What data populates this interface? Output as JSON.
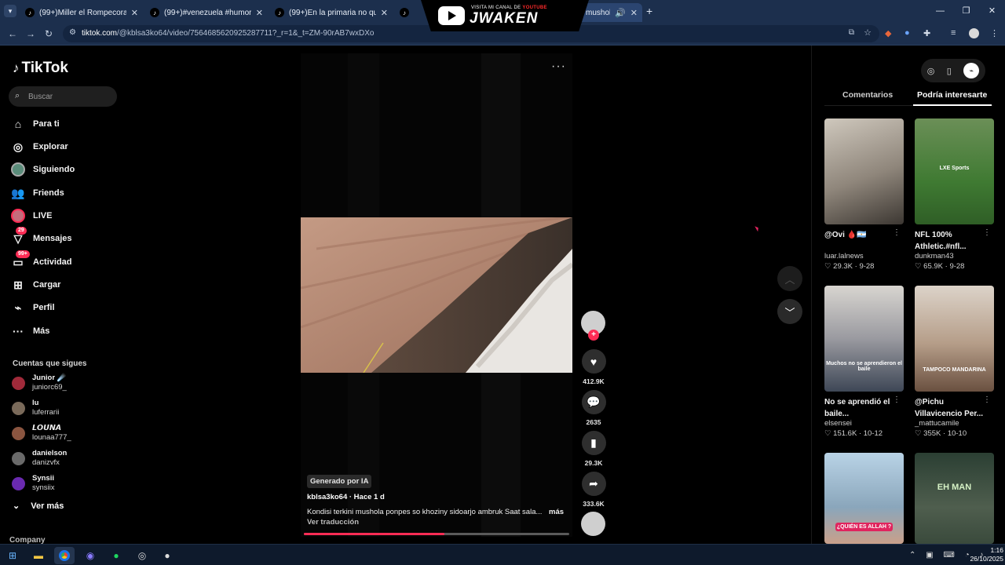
{
  "browser": {
    "tabs": [
      {
        "title": "(99+)Miller el Rompecorazones"
      },
      {
        "title": "(99+)#venezuela #humor #shit"
      },
      {
        "title": "(99+)En la primaria no querías"
      },
      {
        "title": "mushol"
      }
    ],
    "url_host": "tiktok.com",
    "url_path": "/@kblsa3ko64/video/7564685620925287711?_r=1&_t=ZM-90rAB7wxDXo",
    "new_tab": "+"
  },
  "banner": {
    "small_prefix": "VISITA MI CANAL DE",
    "small_brand": "YOUTUBE",
    "title": "JWAKEN"
  },
  "sidebar": {
    "logo": "TikTok",
    "search_placeholder": "Buscar",
    "nav": [
      {
        "label": "Para ti",
        "icon": "home-icon"
      },
      {
        "label": "Explorar",
        "icon": "compass-icon"
      },
      {
        "label": "Siguiendo",
        "icon": "following-avatar-icon"
      },
      {
        "label": "Friends",
        "icon": "friends-icon"
      },
      {
        "label": "LIVE",
        "icon": "live-icon"
      },
      {
        "label": "Mensajes",
        "icon": "messages-icon",
        "badge": "29"
      },
      {
        "label": "Actividad",
        "icon": "activity-icon",
        "badge": "99+"
      },
      {
        "label": "Cargar",
        "icon": "upload-icon"
      },
      {
        "label": "Perfil",
        "icon": "profile-icon"
      },
      {
        "label": "Más",
        "icon": "more-icon"
      }
    ],
    "following_header": "Cuentas que sigues",
    "accounts": [
      {
        "name": "Junior ☄️",
        "handle": "juniorc69_",
        "color": "#a02a3a"
      },
      {
        "name": "lu",
        "handle": "luferrarii",
        "color": "#7a6a5a"
      },
      {
        "name": "𝙇𝙊𝙐𝙉𝘼",
        "handle": "lounaa777_",
        "color": "#8a5540"
      },
      {
        "name": "danielson",
        "handle": "danizvfx",
        "color": "#6a6a6a"
      },
      {
        "name": "Synsii",
        "handle": "synsiix",
        "color": "#6a2ab0"
      }
    ],
    "see_more": "Ver más",
    "company": "Company"
  },
  "video": {
    "ai_badge": "Generado por IA",
    "author_line": "kblsa3ko64 · Hace 1 d",
    "caption": "Kondisi terkini mushola ponpes so khoziny sidoarjo ambruk Saat sala...",
    "more": "más",
    "translate": "Ver traducción",
    "progress": 0.53,
    "likes": "412.9K",
    "comments": "2635",
    "saves": "29.3K",
    "shares": "333.6K"
  },
  "right_panel": {
    "tabs": [
      "Comentarios",
      "Podría interesarte"
    ],
    "active_tab": 1,
    "cards": [
      {
        "title": "@Ovi 🩸🇦🇷",
        "user": "luar.lalnews",
        "likes": "29.3K",
        "date": "9-28",
        "colors": [
          "#bdb6ac",
          "#4a4540"
        ],
        "overlay": ""
      },
      {
        "title": "NFL 100% Athletic.#nfl...",
        "user": "dunkman43",
        "likes": "65.9K",
        "date": "9-28",
        "colors": [
          "#3f7a32",
          "#d6c23a"
        ],
        "overlay": "LXE Sports"
      },
      {
        "title": "No se aprendió el baile...",
        "user": "elsensei",
        "likes": "151.6K",
        "date": "10-12",
        "colors": [
          "#c9c6c1",
          "#3e4756"
        ],
        "overlay": "Muchos no se aprendieron el baile"
      },
      {
        "title": "@Pichu Villavicencio Per...",
        "user": "_mattucamile",
        "likes": "355K",
        "date": "10-10",
        "colors": [
          "#d4c9be",
          "#6a5040"
        ],
        "overlay": "TAMPOCO MANDARINA"
      },
      {
        "title": "",
        "user": "",
        "likes": "",
        "date": "",
        "colors": [
          "#a9c6dc",
          "#7e93a6"
        ],
        "overlay": "¿QUIÉN ES ALLAH ?"
      },
      {
        "title": "",
        "user": "",
        "likes": "",
        "date": "",
        "colors": [
          "#2b3f33",
          "#4f5e4e"
        ],
        "overlay": "EH MAN"
      }
    ]
  },
  "taskbar": {
    "time": "1:16",
    "date": "26/10/2025"
  }
}
